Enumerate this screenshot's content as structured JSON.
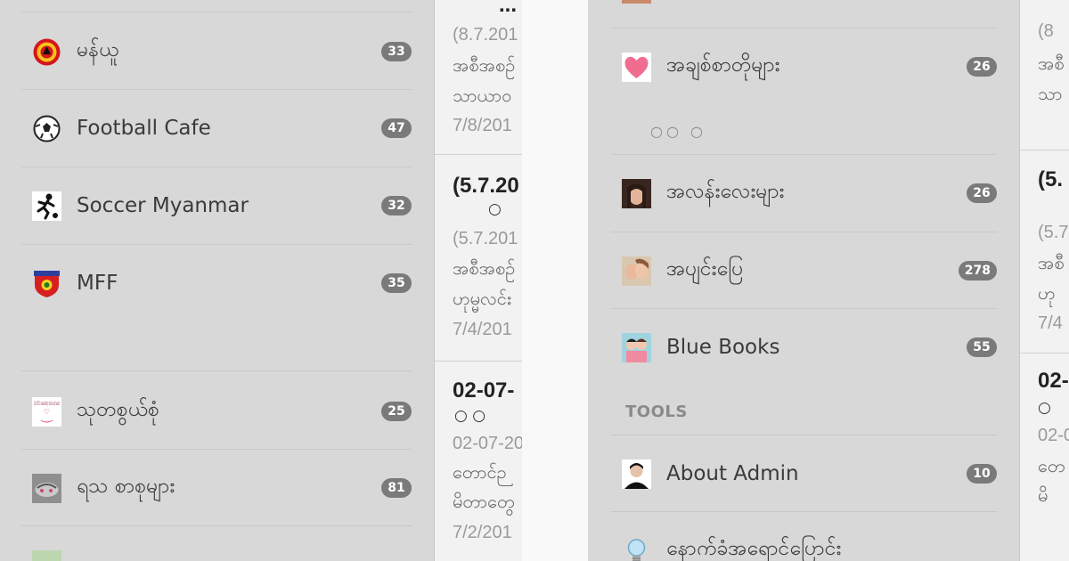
{
  "left_drawer": {
    "items": [
      {
        "label": "မန်ယူ",
        "count": "33",
        "icon": "manchester-united-crest-icon"
      },
      {
        "label": "Football Cafe",
        "count": "47",
        "icon": "soccer-ball-icon"
      },
      {
        "label": "Soccer Myanmar",
        "count": "32",
        "icon": "soccer-player-icon"
      },
      {
        "label": "MFF",
        "count": "35",
        "icon": "mff-crest-icon"
      },
      {
        "label": "သုတစွယ်စုံ",
        "count": "25",
        "icon": "call-911-heart-icon"
      },
      {
        "label": "ရသ စာစုများ",
        "count": "81",
        "icon": "rasa-books-icon"
      }
    ],
    "call_icon_text": "Call 911 somebody stole my heart"
  },
  "left_feed": {
    "posts": [
      {
        "title": "...",
        "date": "(8.7.201",
        "line1": "အစီအစဉ်",
        "line2": "သာယာဝ",
        "footer": "7/8/201"
      },
      {
        "title": "(5.7.20",
        "circles": "○",
        "date": "(5.7.201",
        "line1": "အစီအစဉ်",
        "line2": "ဟုမ္မလင်း",
        "footer": "7/4/201"
      },
      {
        "title": "02-07-",
        "circles": "○  ○",
        "date": "02-07-20",
        "line1": "တောင်ဉ",
        "line2": "မိတာတွေ",
        "footer": "7/2/201"
      }
    ]
  },
  "right_drawer": {
    "items": [
      {
        "label": "အချစ်စာတိုများ",
        "count": "26",
        "icon": "pink-heart-icon"
      },
      {
        "label": "အလန်းလေးများ",
        "count": "26",
        "icon": "model-photo-icon"
      },
      {
        "label": "အပျင်းပြေ",
        "count": "278",
        "icon": "kiss-photo-icon"
      },
      {
        "label": "Blue Books",
        "count": "55",
        "icon": "couple-cartoon-icon"
      }
    ],
    "placeholder_dots": "○○   ○",
    "tools_header": "TOOLS",
    "tools": [
      {
        "label": "About Admin",
        "count": "10",
        "icon": "admin-avatar-icon"
      },
      {
        "label": "နောက်ခံအရောင်ပြောင်း",
        "icon": "light-bulb-icon"
      }
    ]
  },
  "right_feed": {
    "posts": [
      {
        "date": "(8",
        "line1": "အစီ",
        "line2": "သာ"
      },
      {
        "title": "(5.",
        "date": "(5.7",
        "line1": "အစီ",
        "line2": "ဟု",
        "footer": "7/4"
      },
      {
        "title": "02-",
        "circles": "○",
        "date": "02-0",
        "line1": "တေ",
        "line2": "မိ"
      }
    ]
  },
  "colors": {
    "drawer_bg": "#d8d8d8",
    "badge_bg": "#7a7a7a",
    "feed_bg": "#f2f2f2",
    "section_header": "#8a8a8a"
  }
}
